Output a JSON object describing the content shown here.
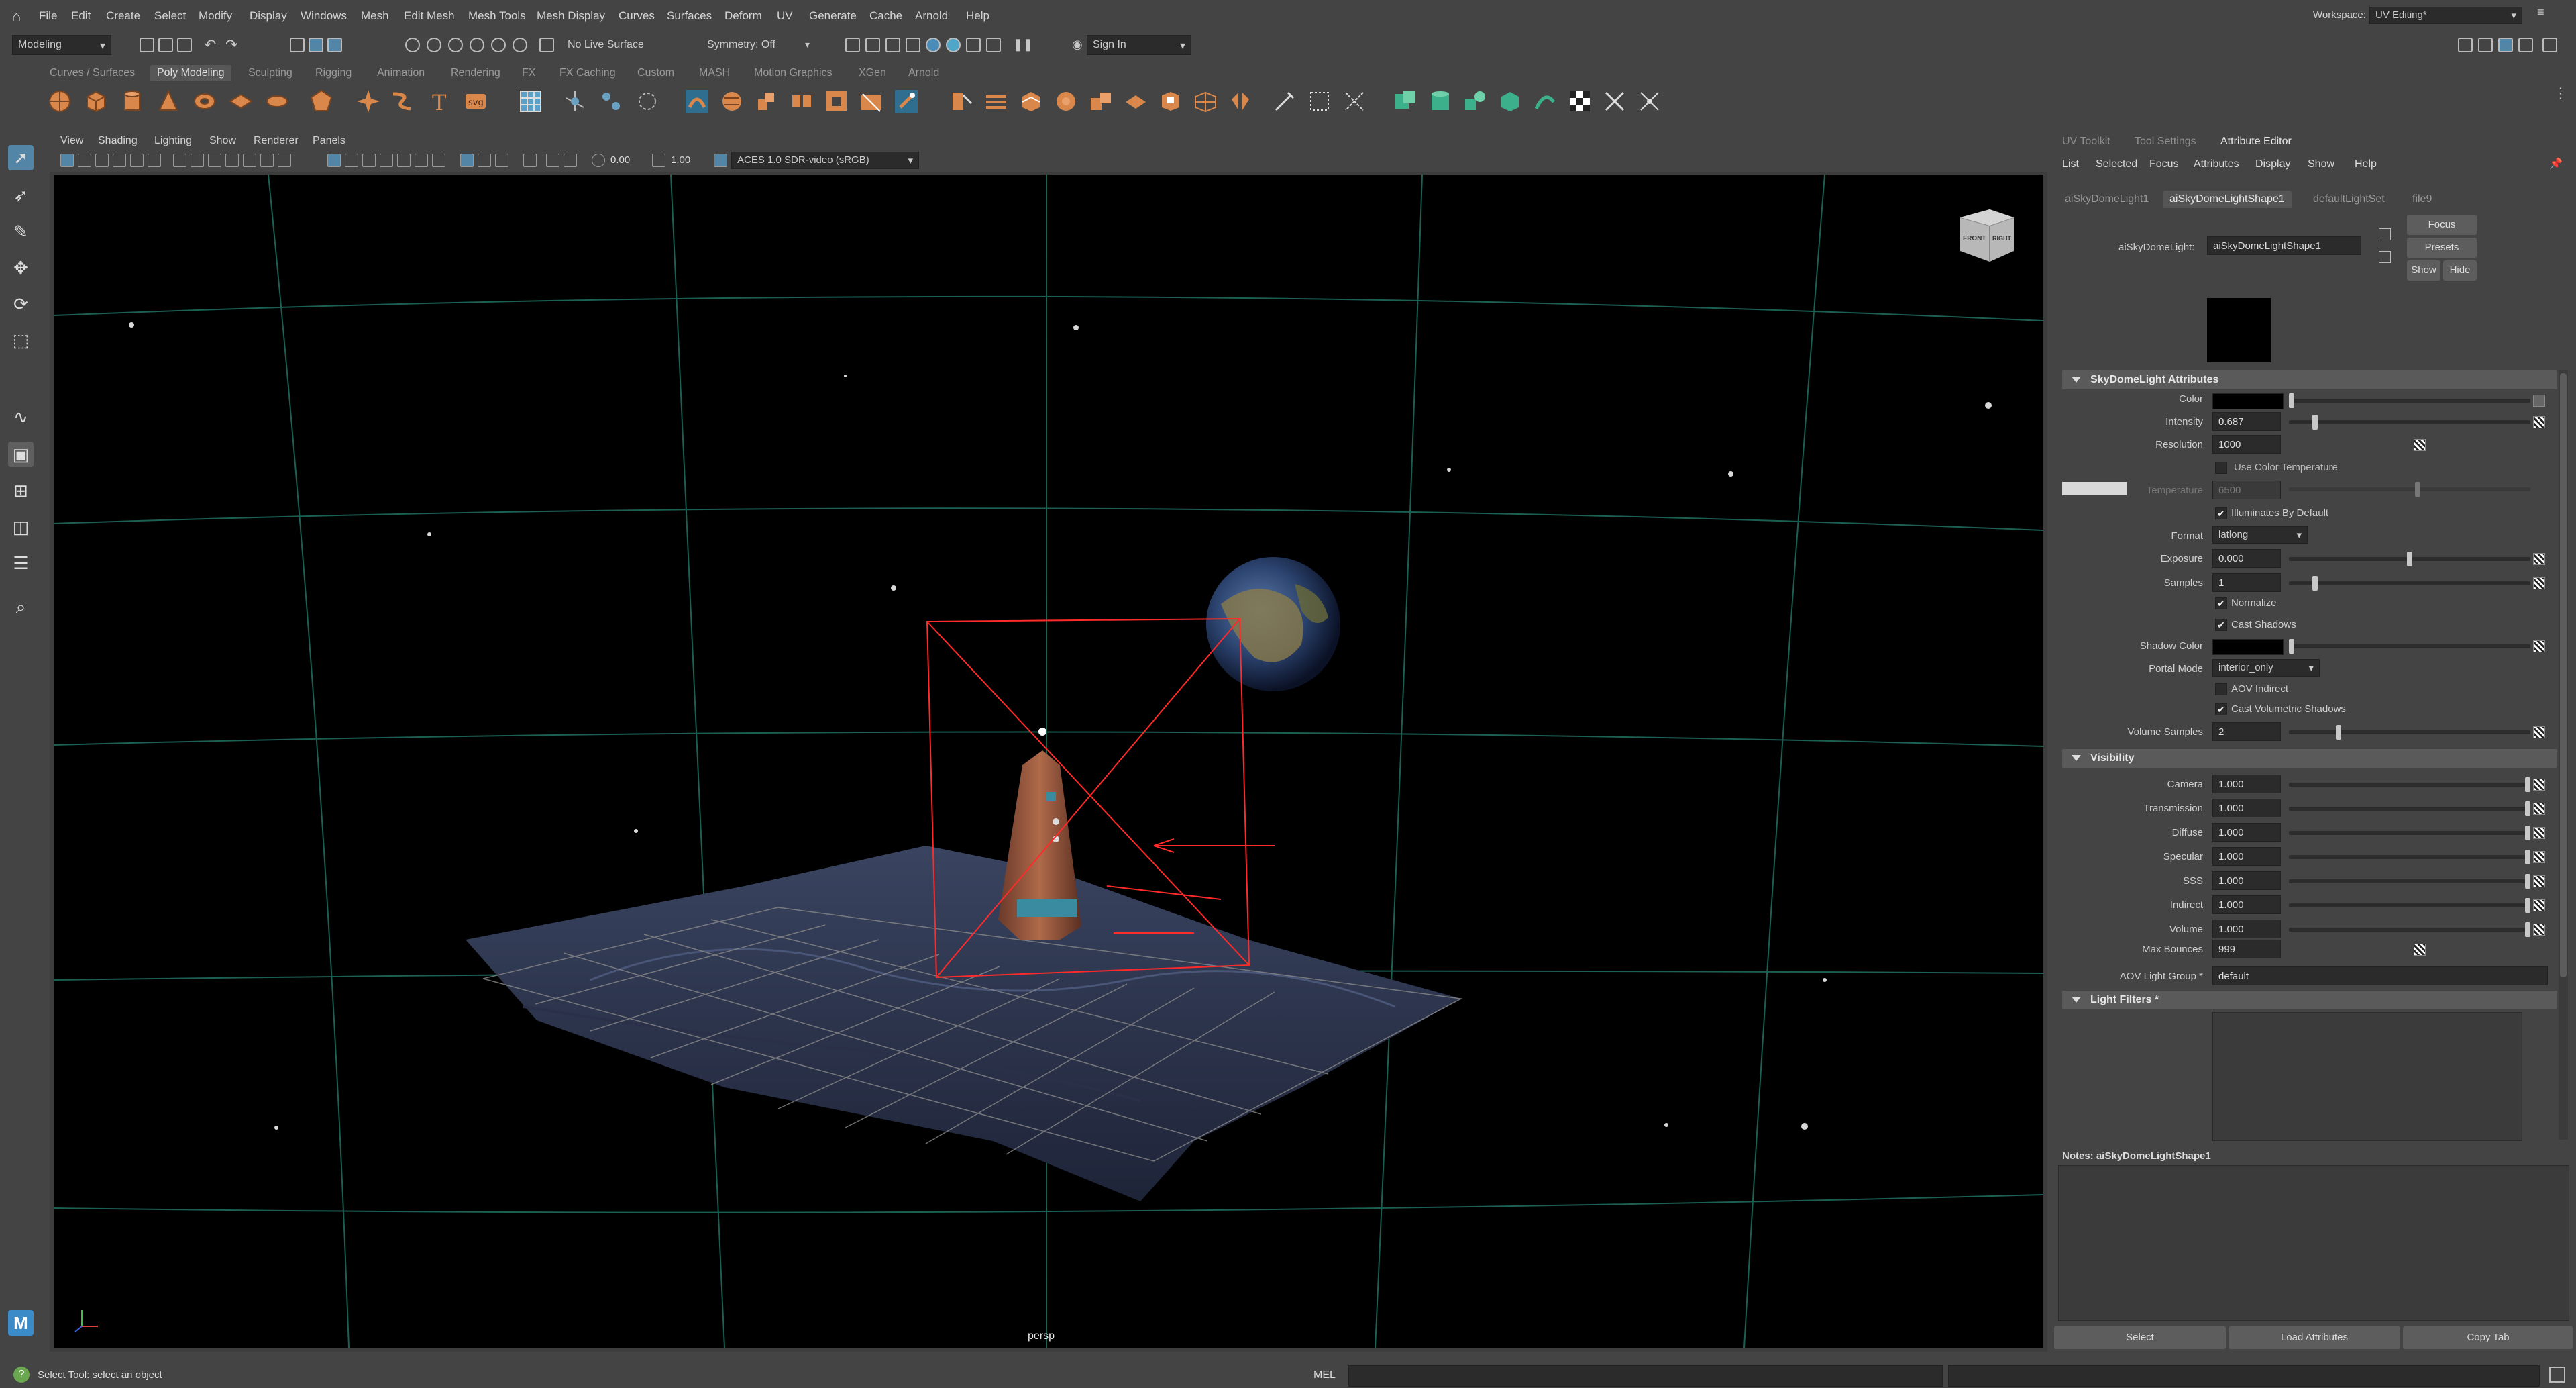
{
  "menubar": {
    "items": [
      "File",
      "Edit",
      "Create",
      "Select",
      "Modify",
      "Display",
      "Windows",
      "Mesh",
      "Edit Mesh",
      "Mesh Tools",
      "Mesh Display",
      "Curves",
      "Surfaces",
      "Deform",
      "UV",
      "Generate",
      "Cache",
      "Arnold",
      "Help"
    ],
    "workspace_label": "Workspace:",
    "workspace_value": "UV Editing*"
  },
  "statusline": {
    "mode": "Modeling",
    "live_surface": "No Live Surface",
    "symmetry": "Symmetry: Off",
    "sign_in": "Sign In"
  },
  "shelf": {
    "tabs": [
      "Curves / Surfaces",
      "Poly Modeling",
      "Sculpting",
      "Rigging",
      "Animation",
      "Rendering",
      "FX",
      "FX Caching",
      "Custom",
      "MASH",
      "Motion Graphics",
      "XGen",
      "Arnold"
    ],
    "active_tab": "Poly Modeling"
  },
  "viewport": {
    "menu": [
      "View",
      "Shading",
      "Lighting",
      "Show",
      "Renderer",
      "Panels"
    ],
    "exposure": "0.00",
    "gamma": "1.00",
    "colorspace": "ACES 1.0 SDR-video (sRGB)",
    "camera_label": "persp",
    "viewcube_front": "FRONT",
    "viewcube_right": "RIGHT"
  },
  "attribute_editor": {
    "panel_tabs": [
      "UV Toolkit",
      "Tool Settings",
      "Attribute Editor"
    ],
    "active_panel_tab": "Attribute Editor",
    "menu": [
      "List",
      "Selected",
      "Focus",
      "Attributes",
      "Display",
      "Show",
      "Help"
    ],
    "node_tabs": [
      "aiSkyDomeLight1",
      "aiSkyDomeLightShape1",
      "defaultLightSet",
      "file9"
    ],
    "active_node_tab": "aiSkyDomeLightShape1",
    "node_type_label": "aiSkyDomeLight:",
    "node_name": "aiSkyDomeLightShape1",
    "buttons": {
      "focus": "Focus",
      "presets": "Presets",
      "show": "Show",
      "hide": "Hide"
    },
    "skydome_section": "SkyDomeLight Attributes",
    "color_label": "Color",
    "intensity_label": "Intensity",
    "intensity": "0.687",
    "intensity_frac": 0.1,
    "resolution_label": "Resolution",
    "resolution": "1000",
    "use_color_temp": "Use Color Temperature",
    "temperature_label": "Temperature",
    "temperature": "6500",
    "illuminates_default": "Illuminates By Default",
    "format_label": "Format",
    "format": "latlong",
    "exposure_label": "Exposure",
    "exposure": "0.000",
    "exposure_frac": 0.5,
    "samples_label": "Samples",
    "samples": "1",
    "samples_frac": 0.1,
    "normalize": "Normalize",
    "cast_shadows": "Cast Shadows",
    "shadow_color_label": "Shadow Color",
    "portal_mode_label": "Portal Mode",
    "portal_mode": "interior_only",
    "aov_indirect": "AOV Indirect",
    "cast_volumetric": "Cast Volumetric Shadows",
    "volume_samples_label": "Volume Samples",
    "volume_samples": "2",
    "volume_samples_frac": 0.2,
    "visibility_section": "Visibility",
    "visibility": [
      {
        "label": "Camera",
        "value": "1.000"
      },
      {
        "label": "Transmission",
        "value": "1.000"
      },
      {
        "label": "Diffuse",
        "value": "1.000"
      },
      {
        "label": "Specular",
        "value": "1.000"
      },
      {
        "label": "SSS",
        "value": "1.000"
      },
      {
        "label": "Indirect",
        "value": "1.000"
      },
      {
        "label": "Volume",
        "value": "1.000"
      }
    ],
    "max_bounces_label": "Max Bounces",
    "max_bounces": "999",
    "aov_group_label": "AOV Light Group *",
    "aov_group": "default",
    "light_filters_section": "Light Filters *",
    "notes_label": "Notes: aiSkyDomeLightShape1",
    "bottom_buttons": [
      "Select",
      "Load Attributes",
      "Copy Tab"
    ]
  },
  "helpline": {
    "text": "Select Tool: select an object",
    "mel_label": "MEL"
  },
  "colors": {
    "accent_orange": "#d9874a",
    "selection_red": "#ff2a2a",
    "grid_teal": "#1f6a5c",
    "panel_bg": "#444444"
  }
}
